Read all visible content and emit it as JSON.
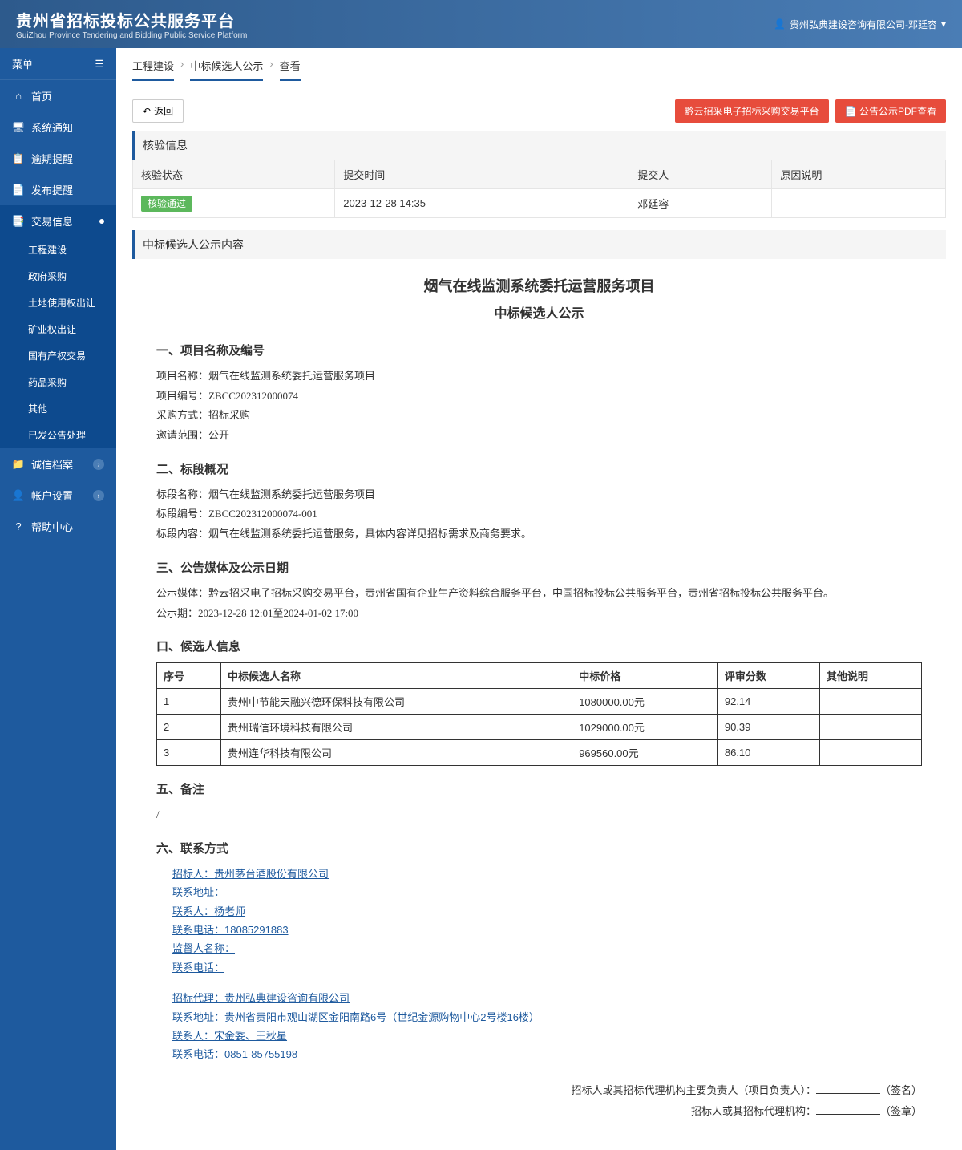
{
  "header": {
    "title": "贵州省招标投标公共服务平台",
    "subtitle": "GuiZhou Province Tendering and Bidding Public Service Platform",
    "user": "贵州弘典建设咨询有限公司-邓廷容"
  },
  "sidebar": {
    "menuLabel": "菜单",
    "items": [
      {
        "icon": "home",
        "label": "首页"
      },
      {
        "icon": "monitor",
        "label": "系统通知"
      },
      {
        "icon": "clock",
        "label": "逾期提醒"
      },
      {
        "icon": "doc",
        "label": "发布提醒"
      },
      {
        "icon": "copy",
        "label": "交易信息"
      }
    ],
    "subitems": [
      "工程建设",
      "政府采购",
      "土地使用权出让",
      "矿业权出让",
      "国有产权交易",
      "药品采购",
      "其他",
      "已发公告处理"
    ],
    "items2": [
      {
        "icon": "folder",
        "label": "诚信档案"
      },
      {
        "icon": "user",
        "label": "帐户设置"
      },
      {
        "icon": "help",
        "label": "帮助中心"
      }
    ]
  },
  "breadcrumb": [
    "工程建设",
    "中标候选人公示",
    "查看"
  ],
  "toolbar": {
    "back": "返回",
    "btn1": "黔云招采电子招标采购交易平台",
    "btn2": "公告公示PDF查看"
  },
  "verify": {
    "title": "核验信息",
    "headers": [
      "核验状态",
      "提交时间",
      "提交人",
      "原因说明"
    ],
    "status": "核验通过",
    "time": "2023-12-28 14:35",
    "submitter": "邓廷容",
    "reason": ""
  },
  "content": {
    "sectionTitle": "中标候选人公示内容",
    "docTitle": "烟气在线监测系统委托运营服务项目",
    "docSubtitle": "中标候选人公示",
    "s1": {
      "title": "一、项目名称及编号",
      "name_label": "项目名称：",
      "name": "烟气在线监测系统委托运营服务项目",
      "code_label": "项目编号：",
      "code": "ZBCC202312000074",
      "method_label": "采购方式：",
      "method": "招标采购",
      "scope_label": "邀请范围：",
      "scope": "公开"
    },
    "s2": {
      "title": "二、标段概况",
      "name_label": "标段名称：",
      "name": "烟气在线监测系统委托运营服务项目",
      "code_label": "标段编号：",
      "code": "ZBCC202312000074-001",
      "content_label": "标段内容：",
      "content": "烟气在线监测系统委托运营服务，具体内容详见招标需求及商务要求。"
    },
    "s3": {
      "title": "三、公告媒体及公示日期",
      "media_label": "公示媒体：",
      "media": "黔云招采电子招标采购交易平台，贵州省国有企业生产资料综合服务平台，中国招标投标公共服务平台，贵州省招标投标公共服务平台。",
      "period_label": "公示期：",
      "period": "2023-12-28 12:01至2024-01-02 17:00"
    },
    "s4": {
      "title": "口、候选人信息",
      "headers": [
        "序号",
        "中标候选人名称",
        "中标价格",
        "评审分数",
        "其他说明"
      ],
      "rows": [
        {
          "no": "1",
          "name": "贵州中节能天融兴德环保科技有限公司",
          "price": "1080000.00元",
          "score": "92.14",
          "other": ""
        },
        {
          "no": "2",
          "name": "贵州瑞信环境科技有限公司",
          "price": "1029000.00元",
          "score": "90.39",
          "other": ""
        },
        {
          "no": "3",
          "name": "贵州连华科技有限公司",
          "price": "969560.00元",
          "score": "86.10",
          "other": ""
        }
      ]
    },
    "s5": {
      "title": "五、备注",
      "body": "/"
    },
    "s6": {
      "title": "六、联系方式",
      "bidder": {
        "org_label": "招标人：",
        "org": "贵州茅台酒股份有限公司",
        "addr_label": "联系地址：",
        "addr": "",
        "contact_label": "联系人：",
        "contact": "杨老师",
        "phone_label": "联系电话：",
        "phone": "18085291883",
        "supervisor_label": "监督人名称：",
        "supervisor": "",
        "sphone_label": "联系电话：",
        "sphone": ""
      },
      "agent": {
        "org_label": "招标代理：",
        "org": "贵州弘典建设咨询有限公司",
        "addr_label": "联系地址：",
        "addr": "贵州省贵阳市观山湖区金阳南路6号（世纪金源购物中心2号楼16楼）",
        "contact_label": "联系人：",
        "contact": "宋金委、王秋星",
        "phone_label": "联系电话：",
        "phone": "0851-85755198"
      }
    },
    "sign": {
      "line1_label": "招标人或其招标代理机构主要负责人（项目负责人）：",
      "line1_suffix": "（签名）",
      "line2_label": "招标人或其招标代理机构：",
      "line2_suffix": "（签章）"
    }
  }
}
